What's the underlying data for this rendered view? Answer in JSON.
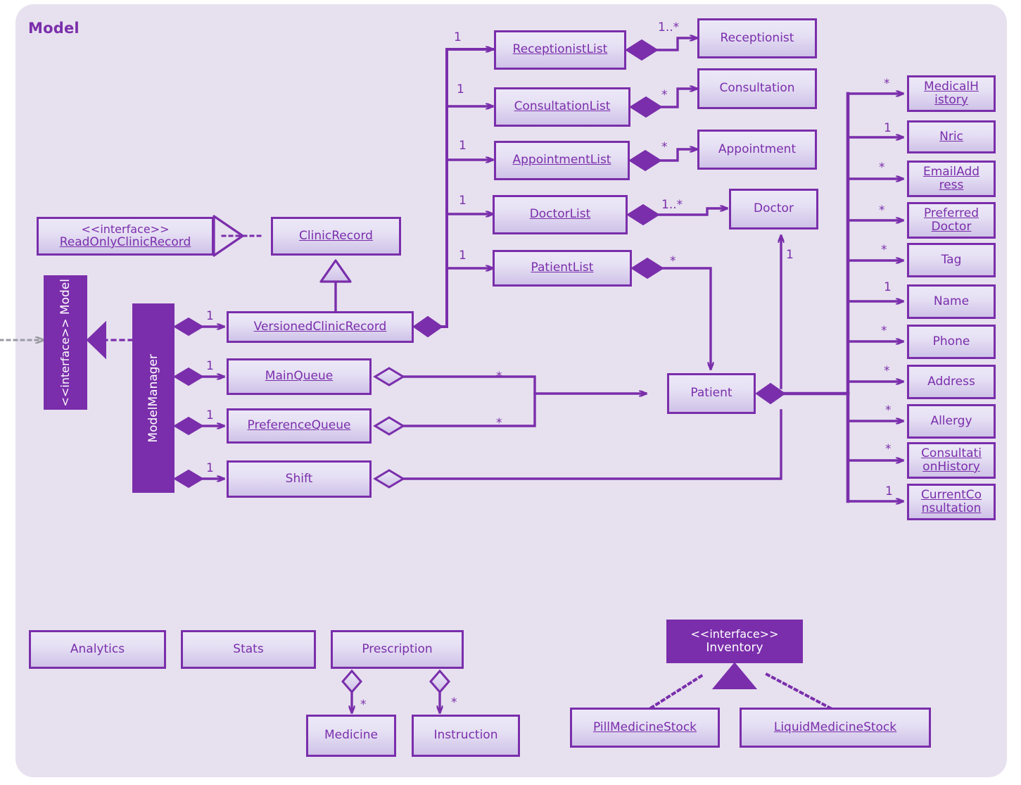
{
  "diagram": {
    "title": "Model",
    "type": "uml-class-diagram",
    "accent_color": "#7a2eab",
    "panel_background": "#e7e1ef",
    "box_fill_top": "#ece8f7",
    "box_fill_bottom": "#cfc2e8"
  },
  "stereotype_label": "<<interface>>",
  "classes": {
    "model_interface": {
      "stereotype": "<<interface>>",
      "name": "Model"
    },
    "model_manager": {
      "name": "ModelManager"
    },
    "read_only_clinic_record": {
      "stereotype": "<<interface>>",
      "name": "ReadOnlyClinicRecord"
    },
    "clinic_record": {
      "name": "ClinicRecord"
    },
    "versioned_clinic_record": {
      "name": "VersionedClinicRecord"
    },
    "main_queue": {
      "name": "MainQueue"
    },
    "preference_queue": {
      "name": "PreferenceQueue"
    },
    "shift": {
      "name": "Shift"
    },
    "receptionist_list": {
      "name": "ReceptionistList"
    },
    "consultation_list": {
      "name": "ConsultationList"
    },
    "appointment_list": {
      "name": "AppointmentList"
    },
    "doctor_list": {
      "name": "DoctorList"
    },
    "patient_list": {
      "name": "PatientList"
    },
    "receptionist": {
      "name": "Receptionist"
    },
    "consultation": {
      "name": "Consultation"
    },
    "appointment": {
      "name": "Appointment"
    },
    "doctor": {
      "name": "Doctor"
    },
    "patient": {
      "name": "Patient"
    },
    "medical_history": {
      "name": "MedicalHistory",
      "line1": "MedicalH",
      "line2": "istory"
    },
    "nric": {
      "name": "Nric"
    },
    "email_address": {
      "name": "EmailAddress",
      "line1": "EmailAdd",
      "line2": "ress"
    },
    "preferred_doctor": {
      "name": "PreferredDoctor",
      "line1": "Preferred",
      "line2": "Doctor"
    },
    "tag": {
      "name": "Tag"
    },
    "name_attr": {
      "name": "Name"
    },
    "phone": {
      "name": "Phone"
    },
    "address": {
      "name": "Address"
    },
    "allergy": {
      "name": "Allergy"
    },
    "consultation_history": {
      "name": "ConsultationHistory",
      "line1": "Consultati",
      "line2": "onHistory"
    },
    "current_consultation": {
      "name": "CurrentConsultation",
      "line1": "CurrentCo",
      "line2": "nsultation"
    },
    "analytics": {
      "name": "Analytics"
    },
    "stats": {
      "name": "Stats"
    },
    "prescription": {
      "name": "Prescription"
    },
    "medicine": {
      "name": "Medicine"
    },
    "instruction": {
      "name": "Instruction"
    },
    "inventory": {
      "stereotype": "<<interface>>",
      "name": "Inventory"
    },
    "pill_medicine_stock": {
      "name": "PillMedicineStock"
    },
    "liquid_medicine_stock": {
      "name": "LiquidMedicineStock"
    }
  },
  "multiplicities": {
    "mm_to_versioned": "1",
    "mm_to_mainqueue": "1",
    "mm_to_preferencequeue": "1",
    "mm_to_shift": "1",
    "vcr_to_receptionistlist": "1",
    "vcr_to_consultationlist": "1",
    "vcr_to_appointmentlist": "1",
    "vcr_to_doctorlist": "1",
    "vcr_to_patientlist": "1",
    "receptionistlist_to_receptionist": "1..*",
    "consultationlist_to_consultation": "*",
    "appointmentlist_to_appointment": "*",
    "doctorlist_to_doctor": "1..*",
    "patientlist_to_patient": "*",
    "mainqueue_to_patient": "*",
    "preferencequeue_to_patient": "*",
    "patient_to_doctor": "1",
    "patient_to_medicalhistory": "*",
    "patient_to_nric": "1",
    "patient_to_emailaddress": "*",
    "patient_to_preferreddoctor": "*",
    "patient_to_tag": "*",
    "patient_to_name": "1",
    "patient_to_phone": "*",
    "patient_to_address": "*",
    "patient_to_allergy": "*",
    "patient_to_consultationhistory": "*",
    "patient_to_currentconsultation": "1",
    "prescription_to_medicine": "*",
    "prescription_to_instruction": "*"
  }
}
